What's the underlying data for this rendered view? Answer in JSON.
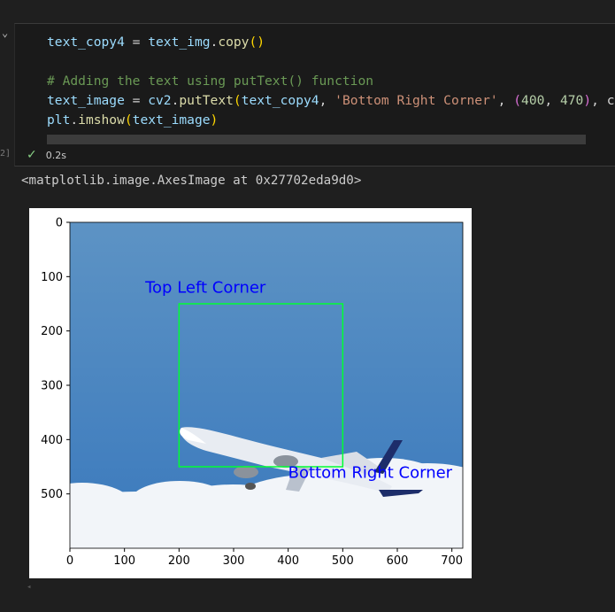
{
  "cell": {
    "code_lines": [
      [
        [
          "v",
          "text_copy4"
        ],
        [
          "o",
          " = "
        ],
        [
          "v",
          "text_img"
        ],
        [
          "o",
          "."
        ],
        [
          "f",
          "copy"
        ],
        [
          "p1",
          "()"
        ]
      ],
      [],
      [
        [
          "c",
          "# Adding the text using putText() function"
        ]
      ],
      [
        [
          "v",
          "text_image"
        ],
        [
          "o",
          " = "
        ],
        [
          "v",
          "cv2"
        ],
        [
          "o",
          "."
        ],
        [
          "f",
          "putText"
        ],
        [
          "p1",
          "("
        ],
        [
          "v",
          "text_copy4"
        ],
        [
          "o",
          ", "
        ],
        [
          "s",
          "'Bottom Right Corner'"
        ],
        [
          "o",
          ", "
        ],
        [
          "p2",
          "("
        ],
        [
          "n",
          "400"
        ],
        [
          "o",
          ", "
        ],
        [
          "n",
          "470"
        ],
        [
          "p2",
          ")"
        ],
        [
          "o",
          ", c"
        ]
      ],
      [
        [
          "v",
          "plt"
        ],
        [
          "o",
          "."
        ],
        [
          "f",
          "imshow"
        ],
        [
          "p1",
          "("
        ],
        [
          "v",
          "text_image"
        ],
        [
          "p1",
          ")"
        ]
      ]
    ],
    "elapsed": "0.2s",
    "exec_count": "2]"
  },
  "output": {
    "text": "<matplotlib.image.AxesImage at 0x27702eda9d0>"
  },
  "chart_data": {
    "type": "image",
    "xlim": [
      0,
      720
    ],
    "ylim": [
      600,
      0
    ],
    "xticks": [
      0,
      100,
      200,
      300,
      400,
      500,
      600,
      700
    ],
    "yticks": [
      0,
      100,
      200,
      300,
      400,
      500
    ],
    "rectangle": {
      "x1": 200,
      "y1": 150,
      "x2": 500,
      "y2": 450,
      "color": "#00ff33"
    },
    "annotations": [
      {
        "text": "Top Left Corner",
        "x": 138,
        "y": 130,
        "color": "#0000ff"
      },
      {
        "text": "Bottom Right Corner",
        "x": 400,
        "y": 470,
        "color": "#0000ff"
      }
    ]
  },
  "colors": {
    "sky_top": "#5d93c4",
    "sky_bottom": "#3a79bd",
    "cloud": "#f2f5f9"
  }
}
